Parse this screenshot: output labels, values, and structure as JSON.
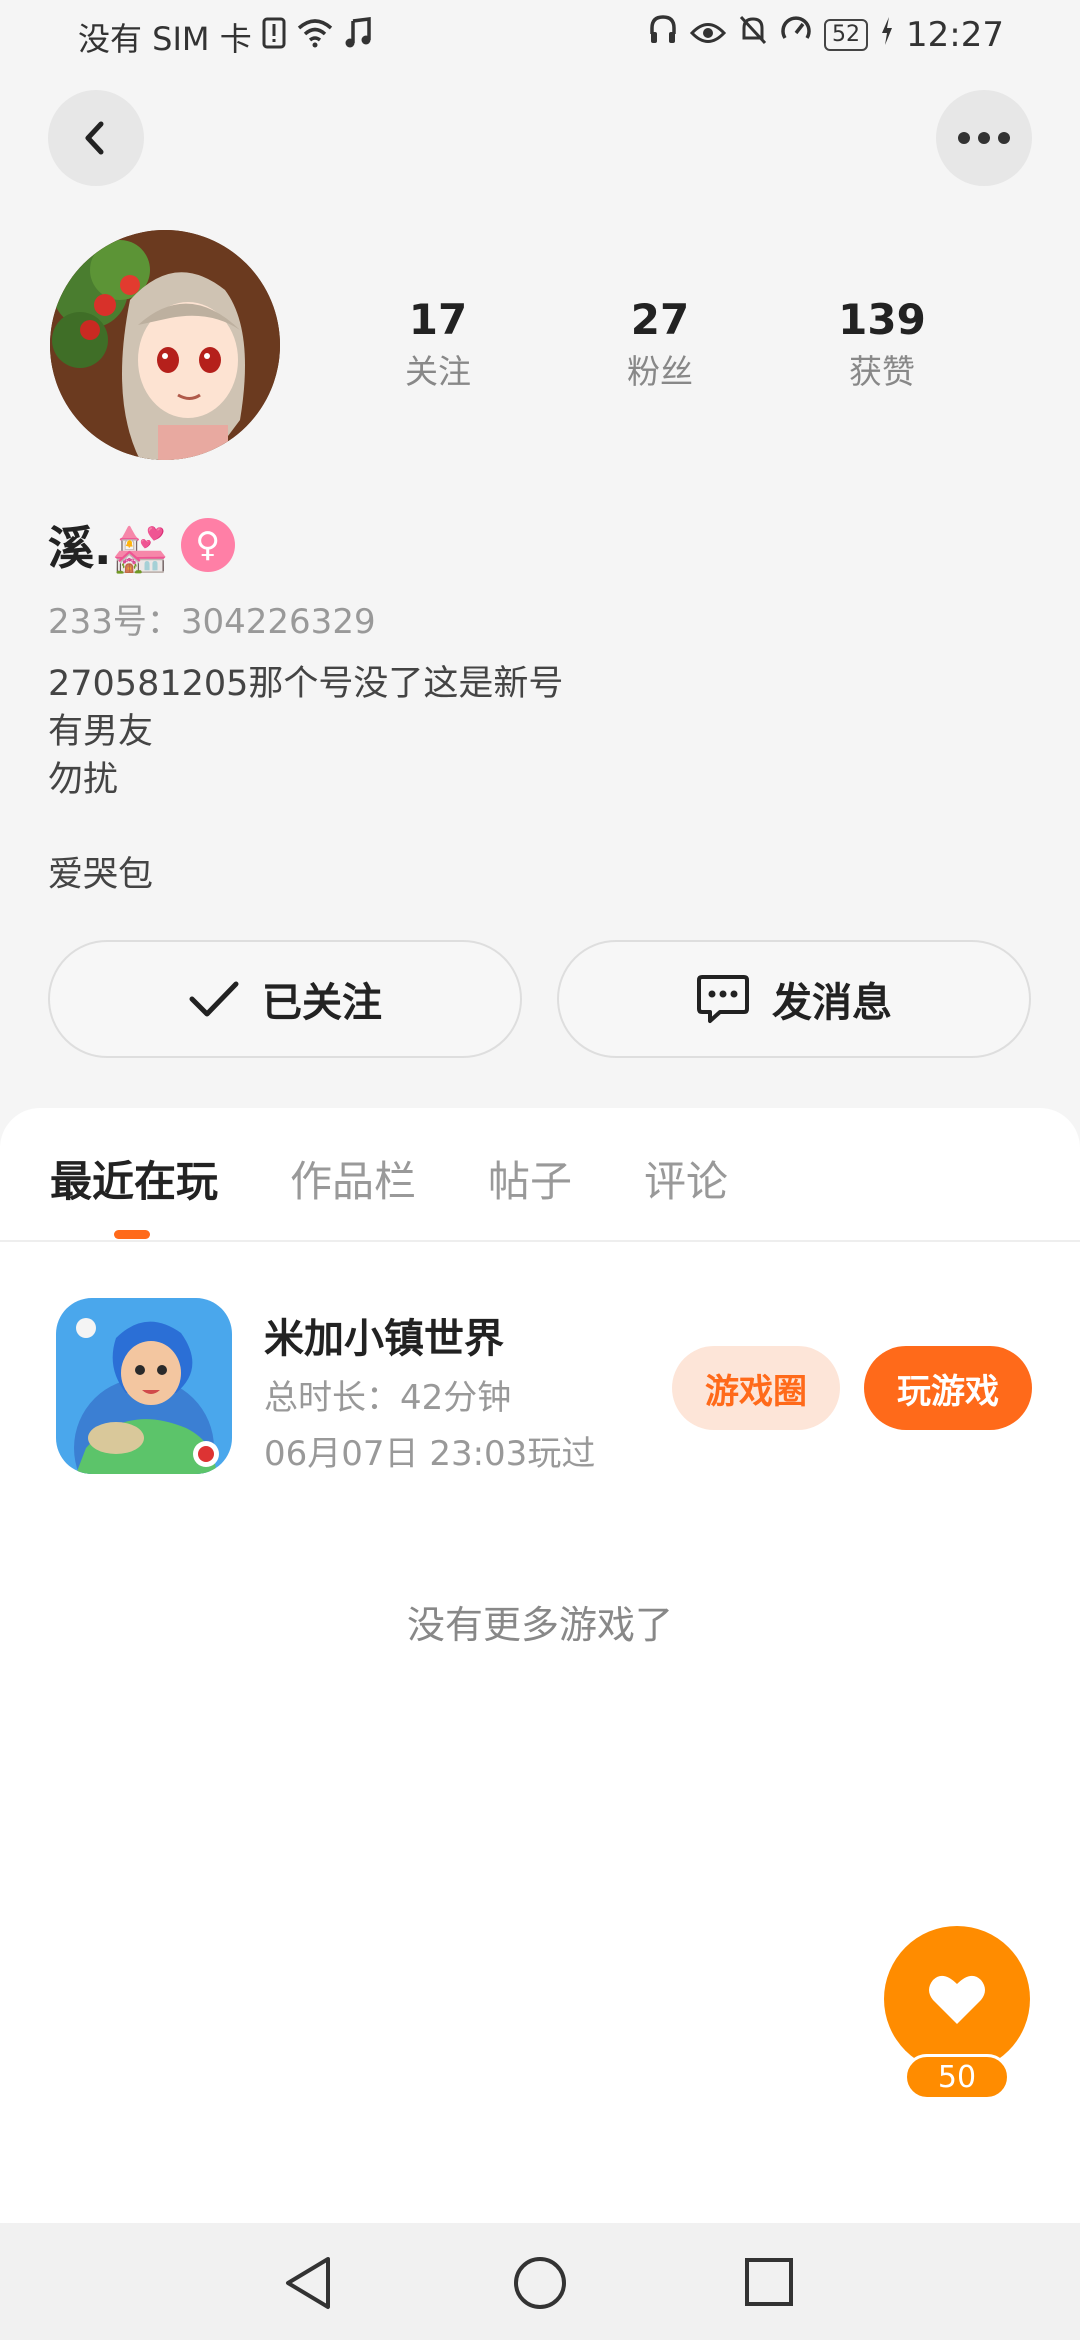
{
  "status_bar": {
    "carrier": "没有 SIM 卡",
    "battery": "52",
    "time": "12:27"
  },
  "profile": {
    "stats": [
      {
        "value": "17",
        "label": "关注"
      },
      {
        "value": "27",
        "label": "粉丝"
      },
      {
        "value": "139",
        "label": "获赞"
      }
    ],
    "username": "溪.💒",
    "gender_symbol": "♀",
    "uid": "233号：304226329",
    "bio_lines": [
      "270581205那个号没了这是新号",
      "有男友",
      "勿扰"
    ],
    "bio_extra": "爱哭包"
  },
  "actions": {
    "followed_label": "已关注",
    "message_label": "发消息"
  },
  "tabs": [
    "最近在玩",
    "作品栏",
    "帖子",
    "评论"
  ],
  "game": {
    "title": "米加小镇世界",
    "total_time": "总时长：42分钟",
    "last_played": "06月07日 23:03玩过",
    "circle_label": "游戏圈",
    "play_label": "玩游戏"
  },
  "no_more_text": "没有更多游戏了",
  "like_count": "50",
  "colors": {
    "accent": "#ff6a1a",
    "fab": "#ff8c00",
    "gender": "#ff7fa6"
  }
}
